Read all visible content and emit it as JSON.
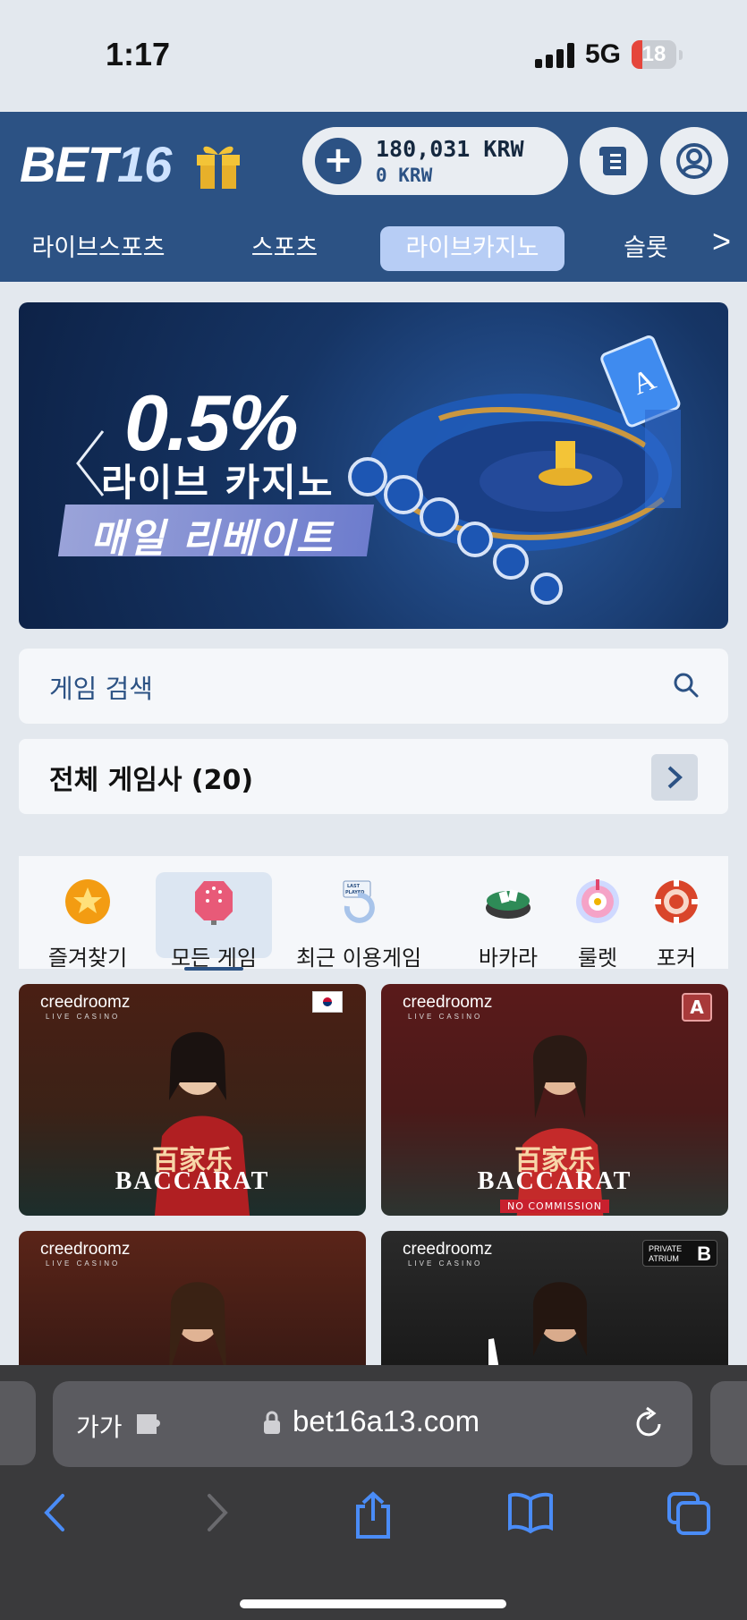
{
  "status_bar": {
    "time": "1:17",
    "network": "5G",
    "battery": "18"
  },
  "header": {
    "logo_text": "BET",
    "logo_num": "16",
    "balance_main": "180,031 KRW",
    "balance_sub": "0 KRW",
    "icons": [
      "plus-icon",
      "gift-icon",
      "receipt-icon",
      "account-icon"
    ]
  },
  "categories": {
    "items": [
      "라이브스포츠",
      "스포츠",
      "라이브카지노",
      "슬롯"
    ],
    "active": "라이브카지노"
  },
  "banner": {
    "percent": "0.5%",
    "line2": "라이브 카지노",
    "line3": "매일 리베이트"
  },
  "search": {
    "placeholder": "게임 검색"
  },
  "providers": {
    "label": "전체 게임사 (20)"
  },
  "filters": {
    "items": [
      "즐겨찾기",
      "모든 게임",
      "최근 이용게임",
      "바카라",
      "룰렛",
      "포커"
    ],
    "active": "모든 게임",
    "recent_icon_text": "LAST PLAYED"
  },
  "games": [
    {
      "brand": "creedroomz",
      "brand_sub": "LIVE CASINO",
      "title_cn": "百家乐",
      "title_en": "BACCARAT",
      "badge": "KR flag"
    },
    {
      "brand": "creedroomz",
      "brand_sub": "LIVE CASINO",
      "title_cn": "百家乐",
      "title_en": "BACCARAT",
      "subtitle": "NO COMMISSION",
      "badge": "A"
    },
    {
      "brand": "creedroomz",
      "brand_sub": "LIVE CASINO"
    },
    {
      "brand": "creedroomz",
      "brand_sub": "LIVE CASINO",
      "badge_line1": "PRIVATE",
      "badge_line2": "ATRIUM",
      "badge": "B"
    }
  ],
  "browser": {
    "text_size": "가가",
    "url": "bet16a13.com"
  },
  "colors": {
    "brand": "#2c5284",
    "active_tab": "#b7cdf5",
    "page_bg": "#e3e8ee"
  }
}
